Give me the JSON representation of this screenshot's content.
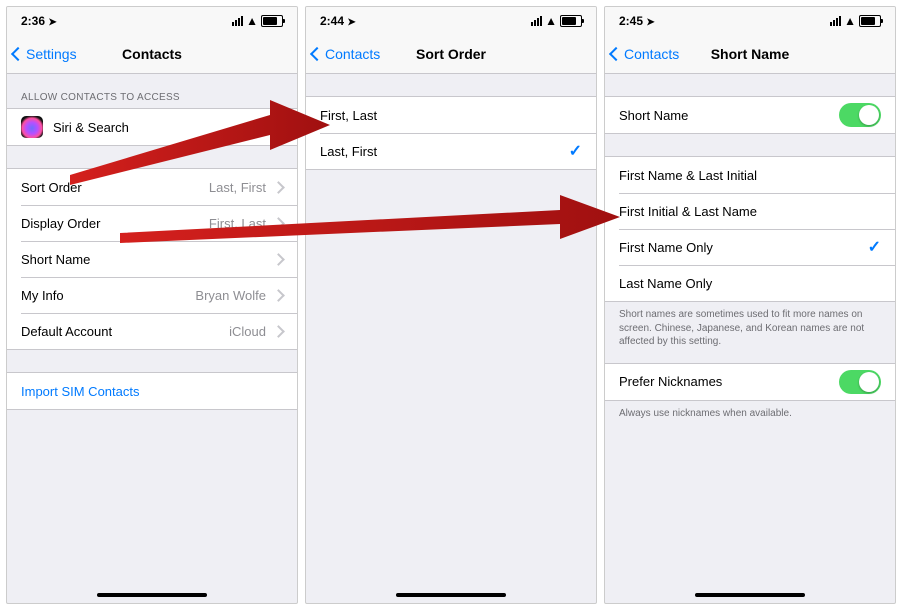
{
  "screens": [
    {
      "time": "2:36",
      "back": "Settings",
      "title": "Contacts",
      "sectionHeader": "ALLOW CONTACTS TO ACCESS",
      "siri": "Siri & Search",
      "rows": [
        {
          "label": "Sort Order",
          "value": "Last, First"
        },
        {
          "label": "Display Order",
          "value": "First, Last"
        },
        {
          "label": "Short Name",
          "value": ""
        },
        {
          "label": "My Info",
          "value": "Bryan Wolfe"
        },
        {
          "label": "Default Account",
          "value": "iCloud"
        }
      ],
      "import": "Import SIM Contacts"
    },
    {
      "time": "2:44",
      "back": "Contacts",
      "title": "Sort Order",
      "options": [
        {
          "label": "First, Last",
          "selected": false
        },
        {
          "label": "Last, First",
          "selected": true
        }
      ]
    },
    {
      "time": "2:45",
      "back": "Contacts",
      "title": "Short Name",
      "toggle1": "Short Name",
      "options": [
        {
          "label": "First Name & Last Initial",
          "selected": false
        },
        {
          "label": "First Initial & Last Name",
          "selected": false
        },
        {
          "label": "First Name Only",
          "selected": true
        },
        {
          "label": "Last Name Only",
          "selected": false
        }
      ],
      "footer1": "Short names are sometimes used to fit more names on screen. Chinese, Japanese, and Korean names are not affected by this setting.",
      "toggle2": "Prefer Nicknames",
      "footer2": "Always use nicknames when available."
    }
  ]
}
